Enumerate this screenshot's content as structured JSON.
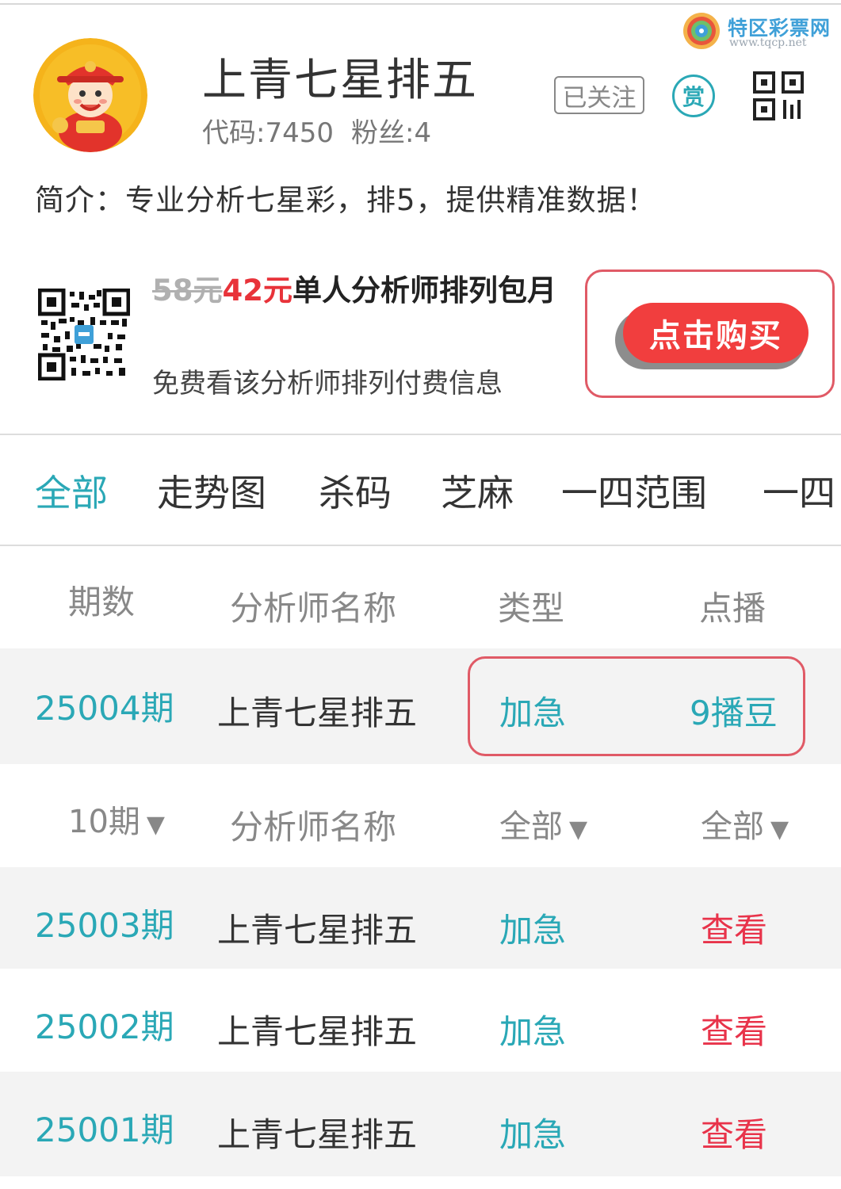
{
  "watermark": {
    "title": "特区彩票网",
    "url": "www.tqcp.net"
  },
  "header": {
    "name": "上青七星排五",
    "code": "代码:7450",
    "fans": "粉丝:4",
    "follow_label": "已关注",
    "reward_label": "赏",
    "intro": "简介：专业分析七星彩，排5，提供精准数据！"
  },
  "promo": {
    "old_price": "58元",
    "new_price": "42元",
    "title": "单人分析师排列包月",
    "subtitle": "免费看该分析师排列付费信息",
    "buy_label": "点击购买"
  },
  "tabs": [
    {
      "label": "全部",
      "active": true
    },
    {
      "label": "走势图"
    },
    {
      "label": "杀码"
    },
    {
      "label": "芝麻"
    },
    {
      "label": "一四范围"
    },
    {
      "label": "一四"
    }
  ],
  "current_table": {
    "headers": [
      "期数",
      "分析师名称",
      "类型",
      "点播"
    ],
    "row": {
      "period": "25004期",
      "analyst": "上青七星排五",
      "type": "加急",
      "price": "9播豆"
    }
  },
  "history_table": {
    "filters": {
      "period": "10期",
      "analyst": "分析师名称",
      "type": "全部",
      "view": "全部"
    },
    "caret": "▼",
    "rows": [
      {
        "period": "25003期",
        "analyst": "上青七星排五",
        "type": "加急",
        "action": "查看"
      },
      {
        "period": "25002期",
        "analyst": "上青七星排五",
        "type": "加急",
        "action": "查看"
      },
      {
        "period": "25001期",
        "analyst": "上青七星排五",
        "type": "加急",
        "action": "查看"
      }
    ]
  },
  "colors": {
    "accent": "#2aa8b6",
    "red": "#e8333a",
    "buy_button": "#f13e3e",
    "row_grey": "#f3f3f3"
  }
}
